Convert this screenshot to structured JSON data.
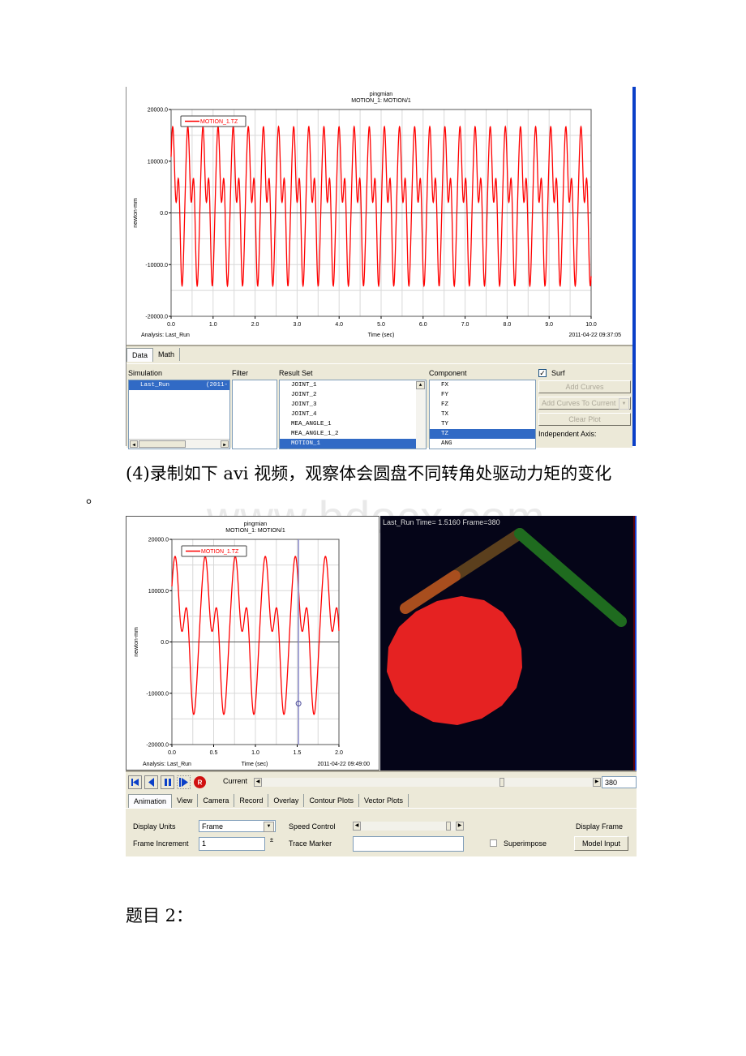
{
  "colors": {
    "curve": "#ff0000",
    "selection": "#316ac5",
    "panel_bg": "#ece9d8",
    "viewport_bg": "#050518",
    "disk": "#e52222",
    "link_crank": "#6b4a1e",
    "link_rocker": "#1f6b1f",
    "cursor_line": "#8a8ac8"
  },
  "figure1": {
    "title": "pingmian",
    "subtitle": "MOTION_1: MOTION/1",
    "footer_left": "Analysis:  Last_Run",
    "footer_center": "Time (sec)",
    "footer_right": "2011-04-22 09:37:05",
    "tabs": [
      {
        "label": "Data",
        "active": true
      },
      {
        "label": "Math",
        "active": false
      }
    ],
    "columns": {
      "simulation": "Simulation",
      "filter": "Filter",
      "result_set": "Result Set",
      "component": "Component"
    },
    "simulation_items": [
      {
        "name": "Last_Run",
        "date": "(2011-",
        "selected": true
      }
    ],
    "result_set_items": [
      {
        "label": "JOINT_1",
        "selected": false
      },
      {
        "label": "JOINT_2",
        "selected": false
      },
      {
        "label": "JOINT_3",
        "selected": false
      },
      {
        "label": "JOINT_4",
        "selected": false
      },
      {
        "label": "MEA_ANGLE_1",
        "selected": false
      },
      {
        "label": "MEA_ANGLE_1_2",
        "selected": false
      },
      {
        "label": "MOTION_1",
        "selected": true
      }
    ],
    "component_items": [
      {
        "label": "FX",
        "selected": false
      },
      {
        "label": "FY",
        "selected": false
      },
      {
        "label": "FZ",
        "selected": false
      },
      {
        "label": "TX",
        "selected": false
      },
      {
        "label": "TY",
        "selected": false
      },
      {
        "label": "TZ",
        "selected": true
      },
      {
        "label": "ANG",
        "selected": false
      }
    ],
    "surf_label": "Surf",
    "surf_checked": true,
    "add_curves": "Add Curves",
    "add_curves_to_current": "Add Curves To Current",
    "clear_plot": "Clear Plot",
    "independent_axis": "Independent Axis:"
  },
  "paragraph_text": "(4)录制如下 avi 视频，观察体会圆盘不同转角处驱动力矩的变化",
  "paragraph_tail": "。",
  "watermark": "www.bdocx.com",
  "figure2": {
    "title": "pingmian",
    "subtitle": "MOTION_1: MOTION/1",
    "footer_left": "Analysis:  Last_Run",
    "footer_center": "Time (sec)",
    "footer_right": "2011-04-22 09:49:00",
    "viewport_label": "Last_Run   Time=  1.5160  Frame=380",
    "current_label": "Current",
    "frame_value": "380",
    "frame_progress": 0.73,
    "tabs": [
      {
        "label": "Animation",
        "active": true
      },
      {
        "label": "View",
        "active": false
      },
      {
        "label": "Camera",
        "active": false
      },
      {
        "label": "Record",
        "active": false
      },
      {
        "label": "Overlay",
        "active": false
      },
      {
        "label": "Contour Plots",
        "active": false
      },
      {
        "label": "Vector Plots",
        "active": false
      }
    ],
    "display_units_label": "Display Units",
    "display_units_value": "Frame",
    "speed_control_label": "Speed Control",
    "speed_progress": 0.95,
    "display_frame_label": "Display Frame",
    "frame_increment_label": "Frame Increment",
    "frame_increment_value": "1",
    "trace_marker_label": "Trace Marker",
    "trace_marker_value": "",
    "superimpose_label": "Superimpose",
    "superimpose_checked": false,
    "model_input": "Model Input",
    "media_buttons": [
      "rewind-to-start",
      "play-reverse",
      "pause",
      "play-forward",
      "record"
    ]
  },
  "heading2": "题目 2：",
  "chart_data": [
    {
      "type": "line",
      "title": "pingmian",
      "subtitle": "MOTION_1: MOTION/1",
      "xlabel": "Time (sec)",
      "ylabel": "newton-mm",
      "xlim": [
        0.0,
        10.0
      ],
      "ylim": [
        -20000.0,
        20000.0
      ],
      "xticks": [
        "0.0",
        "1.0",
        "2.0",
        "3.0",
        "4.0",
        "5.0",
        "6.0",
        "7.0",
        "8.0",
        "9.0",
        "10.0"
      ],
      "yticks": [
        "20000.0",
        "10000.0",
        "0.0",
        "-10000.0",
        "-20000.0"
      ],
      "grid": true,
      "legend": "top-left",
      "series": [
        {
          "name": "MOTION_1.TZ",
          "period": 0.36,
          "peak_max": 16500,
          "secondary_max": 10500,
          "trough_min": -17500,
          "secondary_min": -11500,
          "start_value": 7000
        }
      ]
    },
    {
      "type": "line",
      "title": "pingmian",
      "subtitle": "MOTION_1: MOTION/1",
      "xlabel": "Time (sec)",
      "ylabel": "newton-mm",
      "xlim": [
        0.0,
        2.0
      ],
      "ylim": [
        -20000.0,
        20000.0
      ],
      "xticks": [
        "0.0",
        "0.5",
        "1.0",
        "1.5",
        "2.0"
      ],
      "yticks": [
        "20000.0",
        "10000.0",
        "0.0",
        "-10000.0",
        "-20000.0"
      ],
      "grid": true,
      "legend": "top-left",
      "cursor_time": 1.516,
      "series": [
        {
          "name": "MOTION_1.TZ",
          "period": 0.36,
          "peak_max": 16500,
          "secondary_max": 10500,
          "trough_min": -17500,
          "secondary_min": -11500,
          "start_value": 7000
        }
      ]
    }
  ]
}
